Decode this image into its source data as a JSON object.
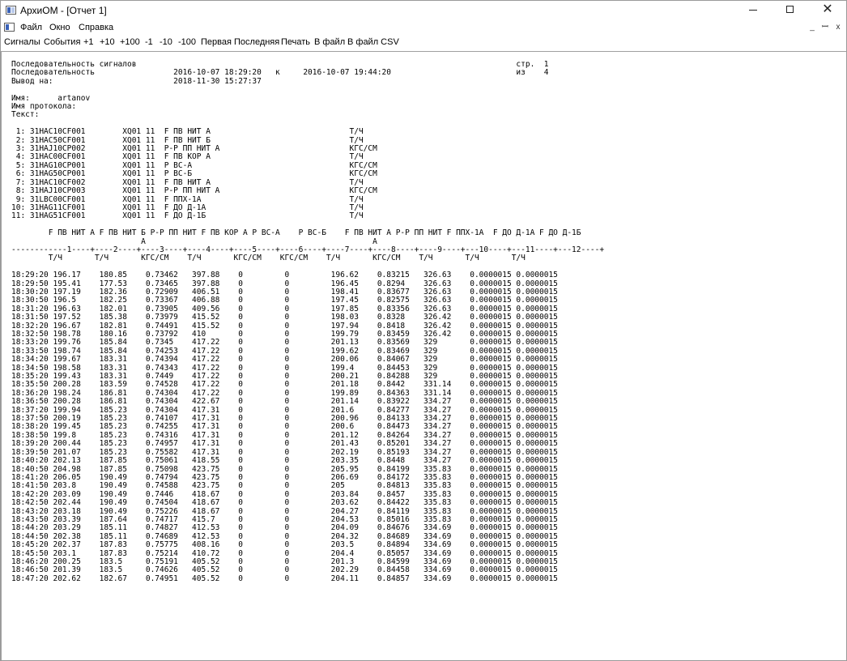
{
  "window": {
    "title": "АрхиОМ - [Отчет 1]",
    "controls": {
      "minimize": "—",
      "maximize": "☐",
      "close": "✕"
    }
  },
  "menu": {
    "items": [
      "Файл",
      "Окно",
      "Справка"
    ],
    "mdi_controls": [
      "_",
      "ꟷ",
      "x"
    ]
  },
  "toolbar": {
    "items": [
      "Сигналы",
      "События",
      "+1",
      "+10",
      "+100",
      "-1",
      "-10",
      "-100",
      "Первая",
      "Последняя",
      "Печать",
      "В файл",
      "В файл CSV"
    ]
  },
  "report": {
    "title": "Последовательность сигналов",
    "page_label": "стр.",
    "page_current": "1",
    "subtitle": "Последовательность",
    "date_from": "2016-10-07 18:29:20",
    "date_sep": "к",
    "date_to": "2016-10-07 19:44:20",
    "of_label": "из",
    "page_total": "4",
    "output_label": "Вывод на:",
    "output_date": "2018-11-30 15:27:37",
    "name_label": "Имя:",
    "name_value": "artanov",
    "protocol_label": "Имя протокола:",
    "text_label": "Текст:",
    "signals": [
      {
        "n": "1:",
        "tag": "31HAC10CF001",
        "sys": "XQ01",
        "code": "11",
        "desc": "F ПВ НИТ А",
        "unit": "Т/Ч"
      },
      {
        "n": "2:",
        "tag": "31HAC50CF001",
        "sys": "XQ01",
        "code": "11",
        "desc": "F ПВ НИТ Б",
        "unit": "Т/Ч"
      },
      {
        "n": "3:",
        "tag": "31HAJ10CP002",
        "sys": "XQ01",
        "code": "11",
        "desc": "P-P ПП НИТ А",
        "unit": "КГС/СМ"
      },
      {
        "n": "4:",
        "tag": "31HAC00CF001",
        "sys": "XQ01",
        "code": "11",
        "desc": "F ПВ КОР А",
        "unit": "Т/Ч"
      },
      {
        "n": "5:",
        "tag": "31HAG10CP001",
        "sys": "XQ01",
        "code": "11",
        "desc": "P ВС-А",
        "unit": "КГС/СМ"
      },
      {
        "n": "6:",
        "tag": "31HAG50CP001",
        "sys": "XQ01",
        "code": "11",
        "desc": "P ВС-Б",
        "unit": "КГС/СМ"
      },
      {
        "n": "7:",
        "tag": "31HAC10CF002",
        "sys": "XQ01",
        "code": "11",
        "desc": "F ПВ НИТ А",
        "unit": "Т/Ч"
      },
      {
        "n": "8:",
        "tag": "31HAJ10CP003",
        "sys": "XQ01",
        "code": "11",
        "desc": "P-P ПП НИТ А",
        "unit": "КГС/СМ"
      },
      {
        "n": "9:",
        "tag": "31LBC00CF001",
        "sys": "XQ01",
        "code": "11",
        "desc": "F ППХ-1А",
        "unit": "Т/Ч"
      },
      {
        "n": "10:",
        "tag": "31HAG11CF001",
        "sys": "XQ01",
        "code": "11",
        "desc": "F ДО Д-1А",
        "unit": "Т/Ч"
      },
      {
        "n": "11:",
        "tag": "31HAG51CF001",
        "sys": "XQ01",
        "code": "11",
        "desc": "F ДО Д-1Б",
        "unit": "Т/Ч"
      }
    ],
    "columns": [
      {
        "name": "F ПВ НИТ А",
        "name2": "",
        "num": "1",
        "unit": "Т/Ч"
      },
      {
        "name": "F ПВ НИТ Б",
        "name2": "",
        "num": "2",
        "unit": "Т/Ч"
      },
      {
        "name": "P-P ПП НИТ",
        "name2": "А",
        "num": "3",
        "unit": "КГС/СМ"
      },
      {
        "name": "F ПВ КОР А",
        "name2": "",
        "num": "4",
        "unit": "Т/Ч"
      },
      {
        "name": "P ВС-А",
        "name2": "",
        "num": "5",
        "unit": "КГС/СМ"
      },
      {
        "name": "P ВС-Б",
        "name2": "",
        "num": "6",
        "unit": "КГС/СМ"
      },
      {
        "name": "F ПВ НИТ А",
        "name2": "",
        "num": "7",
        "unit": "Т/Ч"
      },
      {
        "name": "P-P ПП НИТ",
        "name2": "А",
        "num": "8",
        "unit": "КГС/СМ"
      },
      {
        "name": "F ППХ-1А",
        "name2": "",
        "num": "9",
        "unit": "Т/Ч"
      },
      {
        "name": "F ДО Д-1А",
        "name2": "",
        "num": "10",
        "unit": "Т/Ч"
      },
      {
        "name": "F ДО Д-1Б",
        "name2": "",
        "num": "11",
        "unit": "Т/Ч"
      },
      {
        "name": "",
        "name2": "",
        "num": "12",
        "unit": ""
      }
    ],
    "rows": [
      [
        "18:29:20",
        "196.17",
        "180.85",
        "0.73462",
        "397.88",
        "0",
        "0",
        "196.62",
        "0.83215",
        "326.63",
        "0.0000015",
        "0.0000015"
      ],
      [
        "18:29:50",
        "195.41",
        "177.53",
        "0.73465",
        "397.88",
        "0",
        "0",
        "196.45",
        "0.8294",
        "326.63",
        "0.0000015",
        "0.0000015"
      ],
      [
        "18:30:20",
        "197.19",
        "182.36",
        "0.72909",
        "406.51",
        "0",
        "0",
        "198.41",
        "0.83677",
        "326.63",
        "0.0000015",
        "0.0000015"
      ],
      [
        "18:30:50",
        "196.5",
        "182.25",
        "0.73367",
        "406.88",
        "0",
        "0",
        "197.45",
        "0.82575",
        "326.63",
        "0.0000015",
        "0.0000015"
      ],
      [
        "18:31:20",
        "196.63",
        "182.01",
        "0.73905",
        "409.56",
        "0",
        "0",
        "197.85",
        "0.83356",
        "326.63",
        "0.0000015",
        "0.0000015"
      ],
      [
        "18:31:50",
        "197.52",
        "185.38",
        "0.73979",
        "415.52",
        "0",
        "0",
        "198.03",
        "0.8328",
        "326.42",
        "0.0000015",
        "0.0000015"
      ],
      [
        "18:32:20",
        "196.67",
        "182.81",
        "0.74491",
        "415.52",
        "0",
        "0",
        "197.94",
        "0.8418",
        "326.42",
        "0.0000015",
        "0.0000015"
      ],
      [
        "18:32:50",
        "198.78",
        "180.16",
        "0.73792",
        "410",
        "0",
        "0",
        "199.79",
        "0.83459",
        "326.42",
        "0.0000015",
        "0.0000015"
      ],
      [
        "18:33:20",
        "199.76",
        "185.84",
        "0.7345",
        "417.22",
        "0",
        "0",
        "201.13",
        "0.83569",
        "329",
        "0.0000015",
        "0.0000015"
      ],
      [
        "18:33:50",
        "198.74",
        "185.84",
        "0.74253",
        "417.22",
        "0",
        "0",
        "199.62",
        "0.83469",
        "329",
        "0.0000015",
        "0.0000015"
      ],
      [
        "18:34:20",
        "199.67",
        "183.31",
        "0.74394",
        "417.22",
        "0",
        "0",
        "200.06",
        "0.84067",
        "329",
        "0.0000015",
        "0.0000015"
      ],
      [
        "18:34:50",
        "198.58",
        "183.31",
        "0.74343",
        "417.22",
        "0",
        "0",
        "199.4",
        "0.84453",
        "329",
        "0.0000015",
        "0.0000015"
      ],
      [
        "18:35:20",
        "199.43",
        "183.31",
        "0.7449",
        "417.22",
        "0",
        "0",
        "200.21",
        "0.84288",
        "329",
        "0.0000015",
        "0.0000015"
      ],
      [
        "18:35:50",
        "200.28",
        "183.59",
        "0.74528",
        "417.22",
        "0",
        "0",
        "201.18",
        "0.8442",
        "331.14",
        "0.0000015",
        "0.0000015"
      ],
      [
        "18:36:20",
        "198.24",
        "186.81",
        "0.74304",
        "417.22",
        "0",
        "0",
        "199.89",
        "0.84363",
        "331.14",
        "0.0000015",
        "0.0000015"
      ],
      [
        "18:36:50",
        "200.28",
        "186.81",
        "0.74304",
        "422.67",
        "0",
        "0",
        "201.14",
        "0.83922",
        "334.27",
        "0.0000015",
        "0.0000015"
      ],
      [
        "18:37:20",
        "199.94",
        "185.23",
        "0.74304",
        "417.31",
        "0",
        "0",
        "201.6",
        "0.84277",
        "334.27",
        "0.0000015",
        "0.0000015"
      ],
      [
        "18:37:50",
        "200.19",
        "185.23",
        "0.74107",
        "417.31",
        "0",
        "0",
        "200.96",
        "0.84133",
        "334.27",
        "0.0000015",
        "0.0000015"
      ],
      [
        "18:38:20",
        "199.45",
        "185.23",
        "0.74255",
        "417.31",
        "0",
        "0",
        "200.6",
        "0.84473",
        "334.27",
        "0.0000015",
        "0.0000015"
      ],
      [
        "18:38:50",
        "199.8",
        "185.23",
        "0.74316",
        "417.31",
        "0",
        "0",
        "201.12",
        "0.84264",
        "334.27",
        "0.0000015",
        "0.0000015"
      ],
      [
        "18:39:20",
        "200.44",
        "185.23",
        "0.74957",
        "417.31",
        "0",
        "0",
        "201.43",
        "0.85201",
        "334.27",
        "0.0000015",
        "0.0000015"
      ],
      [
        "18:39:50",
        "201.07",
        "185.23",
        "0.75582",
        "417.31",
        "0",
        "0",
        "202.19",
        "0.85193",
        "334.27",
        "0.0000015",
        "0.0000015"
      ],
      [
        "18:40:20",
        "202.13",
        "187.85",
        "0.75061",
        "418.55",
        "0",
        "0",
        "203.35",
        "0.8448",
        "334.27",
        "0.0000015",
        "0.0000015"
      ],
      [
        "18:40:50",
        "204.98",
        "187.85",
        "0.75098",
        "423.75",
        "0",
        "0",
        "205.95",
        "0.84199",
        "335.83",
        "0.0000015",
        "0.0000015"
      ],
      [
        "18:41:20",
        "206.05",
        "190.49",
        "0.74794",
        "423.75",
        "0",
        "0",
        "206.69",
        "0.84172",
        "335.83",
        "0.0000015",
        "0.0000015"
      ],
      [
        "18:41:50",
        "203.8",
        "190.49",
        "0.74588",
        "423.75",
        "0",
        "0",
        "205",
        "0.84813",
        "335.83",
        "0.0000015",
        "0.0000015"
      ],
      [
        "18:42:20",
        "203.09",
        "190.49",
        "0.7446",
        "418.67",
        "0",
        "0",
        "203.84",
        "0.8457",
        "335.83",
        "0.0000015",
        "0.0000015"
      ],
      [
        "18:42:50",
        "202.44",
        "190.49",
        "0.74504",
        "418.67",
        "0",
        "0",
        "203.62",
        "0.84422",
        "335.83",
        "0.0000015",
        "0.0000015"
      ],
      [
        "18:43:20",
        "203.18",
        "190.49",
        "0.75226",
        "418.67",
        "0",
        "0",
        "204.27",
        "0.84119",
        "335.83",
        "0.0000015",
        "0.0000015"
      ],
      [
        "18:43:50",
        "203.39",
        "187.64",
        "0.74717",
        "415.7",
        "0",
        "0",
        "204.53",
        "0.85016",
        "335.83",
        "0.0000015",
        "0.0000015"
      ],
      [
        "18:44:20",
        "203.29",
        "185.11",
        "0.74827",
        "412.53",
        "0",
        "0",
        "204.09",
        "0.84676",
        "334.69",
        "0.0000015",
        "0.0000015"
      ],
      [
        "18:44:50",
        "202.38",
        "185.11",
        "0.74689",
        "412.53",
        "0",
        "0",
        "204.32",
        "0.84689",
        "334.69",
        "0.0000015",
        "0.0000015"
      ],
      [
        "18:45:20",
        "202.37",
        "187.83",
        "0.75775",
        "408.16",
        "0",
        "0",
        "203.5",
        "0.84894",
        "334.69",
        "0.0000015",
        "0.0000015"
      ],
      [
        "18:45:50",
        "203.1",
        "187.83",
        "0.75214",
        "410.72",
        "0",
        "0",
        "204.4",
        "0.85057",
        "334.69",
        "0.0000015",
        "0.0000015"
      ],
      [
        "18:46:20",
        "200.25",
        "183.5",
        "0.75191",
        "405.52",
        "0",
        "0",
        "201.3",
        "0.84599",
        "334.69",
        "0.0000015",
        "0.0000015"
      ],
      [
        "18:46:50",
        "201.39",
        "183.5",
        "0.74626",
        "405.52",
        "0",
        "0",
        "202.29",
        "0.84458",
        "334.69",
        "0.0000015",
        "0.0000015"
      ],
      [
        "18:47:20",
        "202.62",
        "182.67",
        "0.74951",
        "405.52",
        "0",
        "0",
        "204.11",
        "0.84857",
        "334.69",
        "0.0000015",
        "0.0000015"
      ]
    ]
  }
}
